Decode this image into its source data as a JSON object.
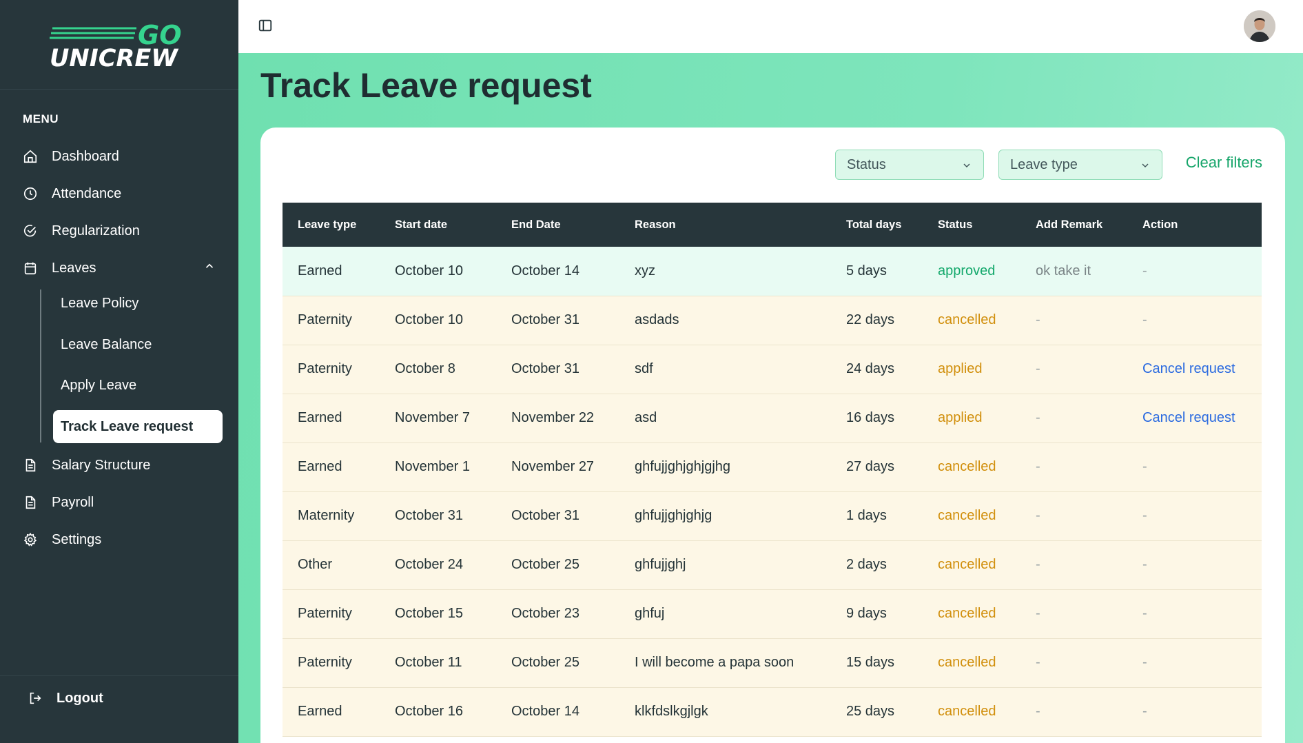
{
  "brand": {
    "logo_line1": "GO",
    "logo_line2": "UNICREW"
  },
  "sidebar": {
    "menu_heading": "MENU",
    "items": [
      {
        "label": "Dashboard",
        "icon": "home-icon"
      },
      {
        "label": "Attendance",
        "icon": "clock-icon"
      },
      {
        "label": "Regularization",
        "icon": "check-circle-icon"
      },
      {
        "label": "Leaves",
        "icon": "calendar-icon"
      }
    ],
    "leave_submenu": [
      {
        "label": "Leave Policy"
      },
      {
        "label": "Leave Balance"
      },
      {
        "label": "Apply Leave"
      },
      {
        "label": "Track Leave request",
        "active": true
      }
    ],
    "items_after": [
      {
        "label": "Salary Structure",
        "icon": "document-icon"
      },
      {
        "label": "Payroll",
        "icon": "document-icon"
      },
      {
        "label": "Settings",
        "icon": "gear-icon"
      }
    ],
    "logout_label": "Logout"
  },
  "page": {
    "title": "Track Leave request"
  },
  "filters": {
    "status_placeholder": "Status",
    "leave_type_placeholder": "Leave type",
    "clear_label": "Clear filters"
  },
  "table": {
    "headers": [
      "Leave type",
      "Start date",
      "End Date",
      "Reason",
      "Total days",
      "Status",
      "Add Remark",
      "Action"
    ],
    "rows": [
      {
        "leave_type": "Earned",
        "start": "October 10",
        "end": "October 14",
        "reason": "xyz",
        "total": "5 days",
        "status": "approved",
        "remark": "ok take it",
        "action": "-"
      },
      {
        "leave_type": "Paternity",
        "start": "October 10",
        "end": "October 31",
        "reason": "asdads",
        "total": "22 days",
        "status": "cancelled",
        "remark": "-",
        "action": "-"
      },
      {
        "leave_type": "Paternity",
        "start": "October 8",
        "end": "October 31",
        "reason": "sdf",
        "total": "24 days",
        "status": "applied",
        "remark": "-",
        "action": "Cancel request"
      },
      {
        "leave_type": "Earned",
        "start": "November 7",
        "end": "November 22",
        "reason": "asd",
        "total": "16 days",
        "status": "applied",
        "remark": "-",
        "action": "Cancel request"
      },
      {
        "leave_type": "Earned",
        "start": "November 1",
        "end": "November 27",
        "reason": "ghfujjghjghjgjhg",
        "total": "27 days",
        "status": "cancelled",
        "remark": "-",
        "action": "-"
      },
      {
        "leave_type": "Maternity",
        "start": "October 31",
        "end": "October 31",
        "reason": "ghfujjghjghjg",
        "total": "1 days",
        "status": "cancelled",
        "remark": "-",
        "action": "-"
      },
      {
        "leave_type": "Other",
        "start": "October 24",
        "end": "October 25",
        "reason": "ghfujjghj",
        "total": "2 days",
        "status": "cancelled",
        "remark": "-",
        "action": "-"
      },
      {
        "leave_type": "Paternity",
        "start": "October 15",
        "end": "October 23",
        "reason": "ghfuj",
        "total": "9 days",
        "status": "cancelled",
        "remark": "-",
        "action": "-"
      },
      {
        "leave_type": "Paternity",
        "start": "October 11",
        "end": "October 25",
        "reason": "I will become a papa soon",
        "total": "15 days",
        "status": "cancelled",
        "remark": "-",
        "action": "-"
      },
      {
        "leave_type": "Earned",
        "start": "October 16",
        "end": "October 14",
        "reason": "klkfdslkgjlgk",
        "total": "25 days",
        "status": "cancelled",
        "remark": "-",
        "action": "-"
      }
    ]
  },
  "colors": {
    "sidebar_bg": "#27363b",
    "accent_green": "#16a56a",
    "status_approved": "#13a86b",
    "status_cancelled": "#d18f0c",
    "link_blue": "#2a6ae0"
  }
}
